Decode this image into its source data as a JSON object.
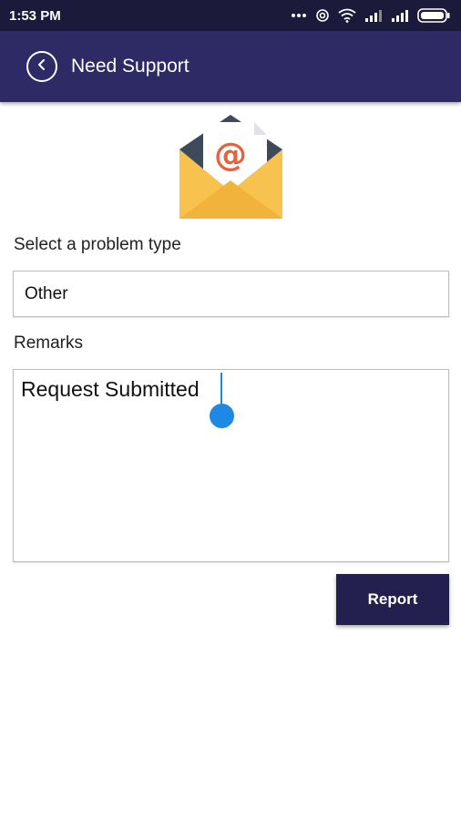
{
  "status_bar": {
    "time": "1:53 PM",
    "battery_icon": "battery-icon",
    "icons": [
      "more-dots-icon",
      "hotspot-icon",
      "wifi-icon",
      "signal-icon",
      "signal-icon",
      "battery-icon"
    ]
  },
  "app_bar": {
    "title": "Need Support",
    "back_icon": "back-chevron-icon",
    "color": "#2e2a66"
  },
  "hero": {
    "icon": "email-envelope-icon"
  },
  "form": {
    "problem_type_label": "Select a problem type",
    "problem_type_value": "Other",
    "remarks_label": "Remarks",
    "remarks_value": "Request Submitted"
  },
  "actions": {
    "report_label": "Report",
    "report_color": "#232050"
  },
  "colors": {
    "accent_cursor": "#1e88e5",
    "status_bar": "#1b1a3b"
  }
}
